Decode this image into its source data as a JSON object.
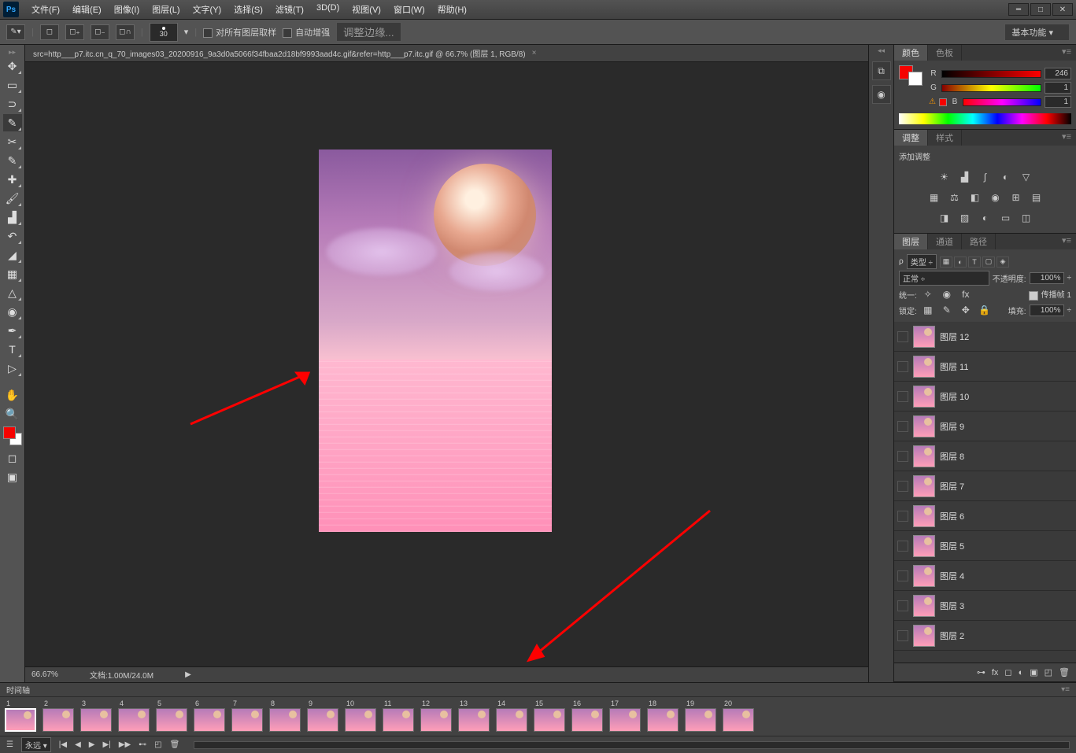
{
  "menus": [
    "文件(F)",
    "编辑(E)",
    "图像(I)",
    "图层(L)",
    "文字(Y)",
    "选择(S)",
    "滤镜(T)",
    "3D(D)",
    "视图(V)",
    "窗口(W)",
    "帮助(H)"
  ],
  "options": {
    "brush_size": "30",
    "sample_all": "对所有图层取样",
    "auto_enhance": "自动增强",
    "refine_edge": "调整边缘..."
  },
  "workspace": "基本功能",
  "document": {
    "tab": "src=http___p7.itc.cn_q_70_images03_20200916_9a3d0a5066f34fbaa2d18bf9993aad4c.gif&refer=http___p7.itc.gif @ 66.7% (图层 1, RGB/8)",
    "zoom": "66.67%",
    "doc_label": "文档",
    "doc_size": ":1.00M/24.0M"
  },
  "color_panel": {
    "tabs": [
      "颜色",
      "色板"
    ],
    "fg": "#f60200",
    "labels": {
      "r": "R",
      "g": "G",
      "b": "B"
    },
    "r": "246",
    "g": "1",
    "b": "1"
  },
  "adjust_panel": {
    "tabs": [
      "调整",
      "样式"
    ],
    "title": "添加调整"
  },
  "layers_panel": {
    "tabs": [
      "图层",
      "通道",
      "路径"
    ],
    "kind_label": "类型",
    "blend": "正常",
    "opacity_label": "不透明度:",
    "opacity": "100%",
    "unify_label": "统一:",
    "propagate": "传播帧 1",
    "lock_label": "锁定:",
    "fill_label": "填充:",
    "fill": "100%",
    "layers": [
      {
        "name": "图层 12"
      },
      {
        "name": "图层 11"
      },
      {
        "name": "图层 10"
      },
      {
        "name": "图层 9"
      },
      {
        "name": "图层 8"
      },
      {
        "name": "图层 7"
      },
      {
        "name": "图层 6"
      },
      {
        "name": "图层 5"
      },
      {
        "name": "图层 4"
      },
      {
        "name": "图层 3"
      },
      {
        "name": "图层 2"
      }
    ]
  },
  "timeline": {
    "title": "时间轴",
    "frames": [
      1,
      2,
      3,
      4,
      5,
      6,
      7,
      8,
      9,
      10,
      11,
      12,
      13,
      14,
      15,
      16,
      17,
      18,
      19,
      20
    ],
    "forever": "永远"
  }
}
